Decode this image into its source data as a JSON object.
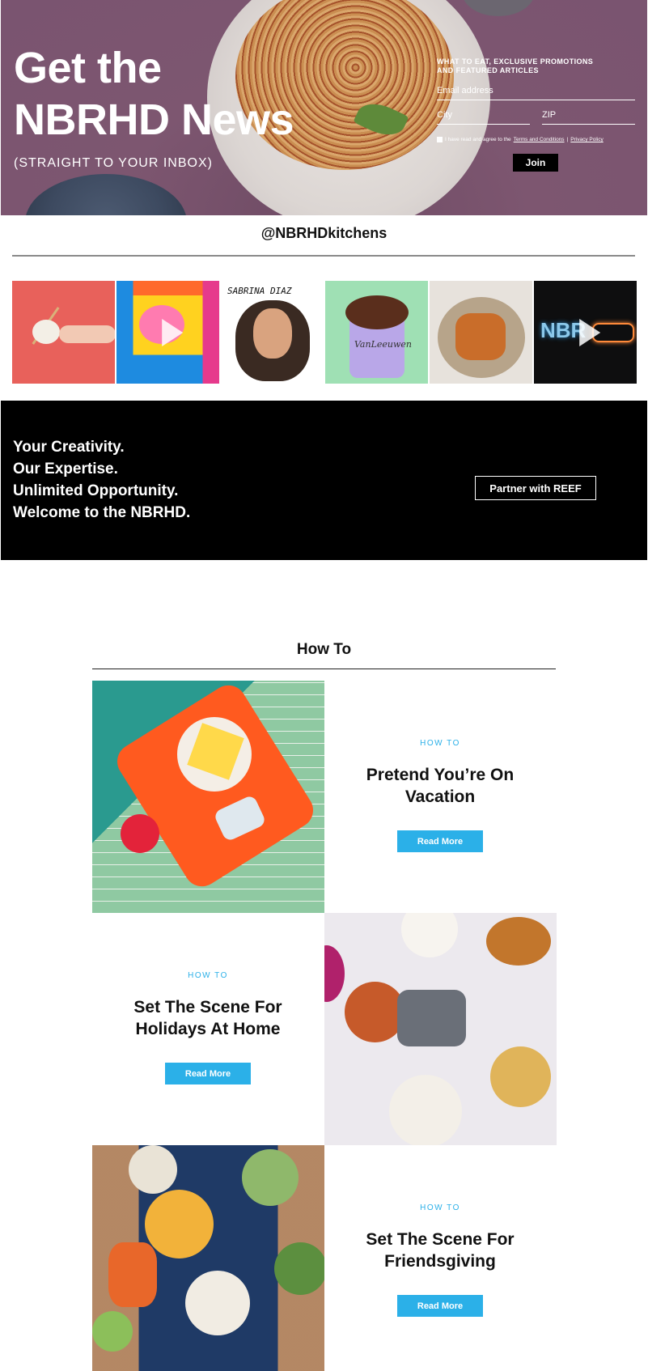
{
  "hero": {
    "title_line1": "Get the",
    "title_line2": "NBRHD News",
    "subtitle": "(STRAIGHT TO YOUR INBOX)",
    "signup": {
      "kicker_line1": "WHAT TO EAT, EXCLUSIVE PROMOTIONS",
      "kicker_line2": "AND FEATURED ARTICLES",
      "email_placeholder": "Email address",
      "city_placeholder": "City",
      "zip_placeholder": "ZIP",
      "agree_text": "I have read and agree to the",
      "terms_link": "Terms and Conditions",
      "separator": "|",
      "privacy_link": "Privacy Policy",
      "join_label": "Join"
    }
  },
  "social": {
    "handle": "@NBRHDkitchens",
    "tiles": [
      {
        "name": "dumpling-photo",
        "has_play": false
      },
      {
        "name": "neighborhood-poster",
        "has_play": true
      },
      {
        "name": "sabrina-diaz-illustration",
        "caption": "SABRINA DIAZ",
        "has_play": false
      },
      {
        "name": "ice-cream-cup",
        "brand": "VanLeeuwen",
        "has_play": false
      },
      {
        "name": "burgers-platter",
        "has_play": false
      },
      {
        "name": "neon-sign",
        "text": "NBR",
        "has_play": true
      }
    ]
  },
  "promo": {
    "lines": [
      "Your Creativity.",
      "Our Expertise.",
      "Unlimited Opportunity.",
      "Welcome to the NBRHD."
    ],
    "button_label": "Partner with REEF"
  },
  "howto": {
    "section_title": "How To",
    "cards": [
      {
        "category": "HOW TO",
        "title": "Pretend You’re On Vacation",
        "button": "Read More"
      },
      {
        "category": "HOW TO",
        "title": "Set The Scene For Holidays At Home",
        "button": "Read More"
      },
      {
        "category": "HOW TO",
        "title": "Set The Scene For Friendsgiving",
        "button": "Read More"
      }
    ]
  },
  "colors": {
    "hero_bg": "#7a5470",
    "accent_blue": "#2bb0e8",
    "promo_bg": "#000000"
  }
}
